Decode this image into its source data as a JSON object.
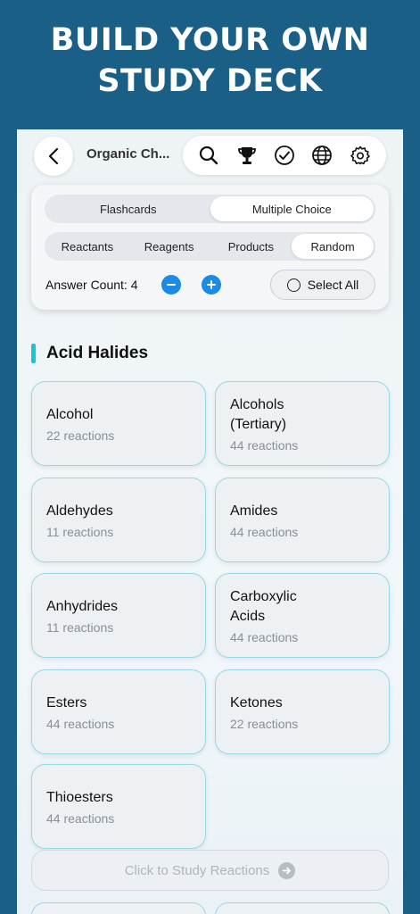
{
  "headline": {
    "line1": "BUILD YOUR OWN",
    "line2": "STUDY DECK"
  },
  "nav": {
    "title": "Organic Ch...",
    "icons": [
      "back-chevron-icon",
      "search-icon",
      "trophy-icon",
      "checkmark-circle-icon",
      "globe-icon",
      "gear-icon"
    ]
  },
  "mode_tabs": [
    {
      "label": "Flashcards",
      "selected": false
    },
    {
      "label": "Multiple Choice",
      "selected": true
    }
  ],
  "kind_tabs": [
    {
      "label": "Reactants",
      "selected": false
    },
    {
      "label": "Reagents",
      "selected": false
    },
    {
      "label": "Products",
      "selected": false
    },
    {
      "label": "Random",
      "selected": true
    }
  ],
  "answer_count": {
    "label": "Answer Count: 4",
    "value": 4
  },
  "select_all_label": "Select All",
  "section_title": "Acid Halides",
  "cards": [
    {
      "name": "Alcohol",
      "count": "22 reactions"
    },
    {
      "name": "Alcohols\n(Tertiary)",
      "count": "44 reactions"
    },
    {
      "name": "Aldehydes",
      "count": "11 reactions"
    },
    {
      "name": "Amides",
      "count": "44 reactions"
    },
    {
      "name": "Anhydrides",
      "count": "11 reactions"
    },
    {
      "name": "Carboxylic\nAcids",
      "count": "44 reactions"
    },
    {
      "name": "Esters",
      "count": "44 reactions"
    },
    {
      "name": "Ketones",
      "count": "22 reactions"
    },
    {
      "name": "Thioesters",
      "count": "44 reactions"
    }
  ],
  "study_button_label": "Click to Study Reactions",
  "colors": {
    "background": "#1a5f86",
    "accent": "#1b8be6",
    "section_bar": "#16c6d4",
    "card_border": "#9ad8e6"
  }
}
